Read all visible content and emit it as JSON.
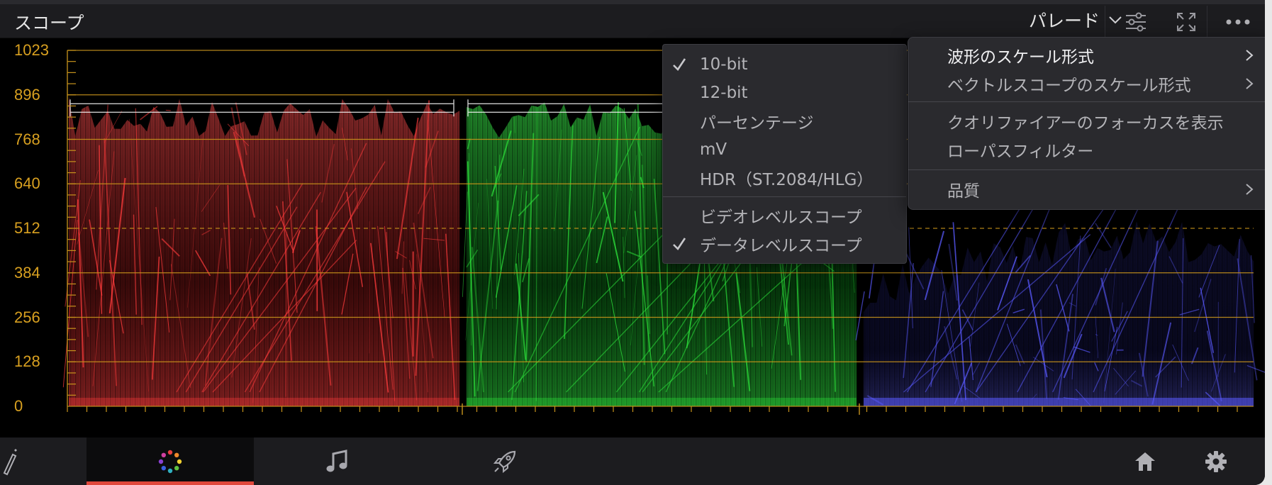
{
  "header": {
    "title": "スコープ",
    "mode": "パレード",
    "icons": [
      "chevron-down-icon",
      "sliders-icon",
      "expand-icon",
      "more-icon"
    ]
  },
  "scope": {
    "y_axis_labels": [
      "1023",
      "896",
      "768",
      "640",
      "512",
      "384",
      "256",
      "128",
      "0"
    ],
    "channels": [
      "red",
      "green",
      "blue"
    ],
    "colors": {
      "graticule": "#c8941c",
      "label": "#d8a020",
      "red": "#ff3c3c",
      "green": "#2ee63c",
      "blue": "#5a5aff"
    }
  },
  "scale_menu": {
    "items": [
      {
        "label": "10-bit",
        "checked": true
      },
      {
        "label": "12-bit",
        "checked": false
      },
      {
        "label": "パーセンテージ",
        "checked": false
      },
      {
        "label": "mV",
        "checked": false
      },
      {
        "label": "HDR（ST.2084/HLG）",
        "checked": false
      }
    ],
    "level_items": [
      {
        "label": "ビデオレベルスコープ",
        "checked": false
      },
      {
        "label": "データレベルスコープ",
        "checked": true
      }
    ]
  },
  "options_menu": {
    "items": [
      {
        "label": "波形のスケール形式",
        "submenu": true,
        "highlighted": true
      },
      {
        "label": "ベクトルスコープのスケール形式",
        "submenu": true,
        "highlighted": false
      },
      {
        "label": "クオリファイアーのフォーカスを表示",
        "submenu": false,
        "highlighted": false
      },
      {
        "label": "ローパスフィルター",
        "submenu": false,
        "highlighted": false
      },
      {
        "label": "品質",
        "submenu": true,
        "highlighted": false
      }
    ]
  },
  "footer": {
    "pages": [
      {
        "name": "edit",
        "icon": "pen-icon"
      },
      {
        "name": "color",
        "icon": "color-wheel-icon",
        "active": true
      },
      {
        "name": "fairlight",
        "icon": "music-note-icon"
      },
      {
        "name": "deliver",
        "icon": "rocket-icon"
      }
    ],
    "icons": [
      "home-icon",
      "gear-icon"
    ],
    "accent": "#e0483c"
  }
}
